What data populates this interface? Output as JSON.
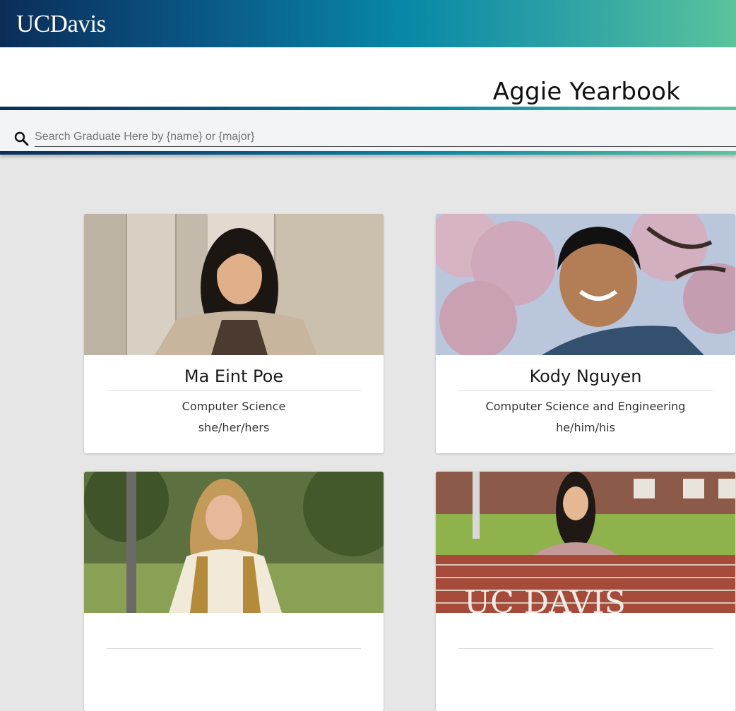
{
  "header": {
    "logo": "UCDavis",
    "title": "Aggie Yearbook"
  },
  "search": {
    "placeholder": "Search Graduate Here by {name} or {major}",
    "value": ""
  },
  "graduates": [
    {
      "name": "Ma Eint Poe",
      "major": "Computer Science",
      "pronouns": "she/her/hers"
    },
    {
      "name": "Kody Nguyen",
      "major": "Computer Science and Engineering",
      "pronouns": "he/him/his"
    },
    {
      "name": "",
      "major": "",
      "pronouns": ""
    },
    {
      "name": "",
      "major": "",
      "pronouns": "",
      "sign_text": "UC DAVIS"
    }
  ],
  "colors": {
    "brand_dark": "#0b2d58",
    "brand_teal": "#0888a6",
    "brand_green": "#5ac49c",
    "page_bg": "#e6e6e6"
  }
}
